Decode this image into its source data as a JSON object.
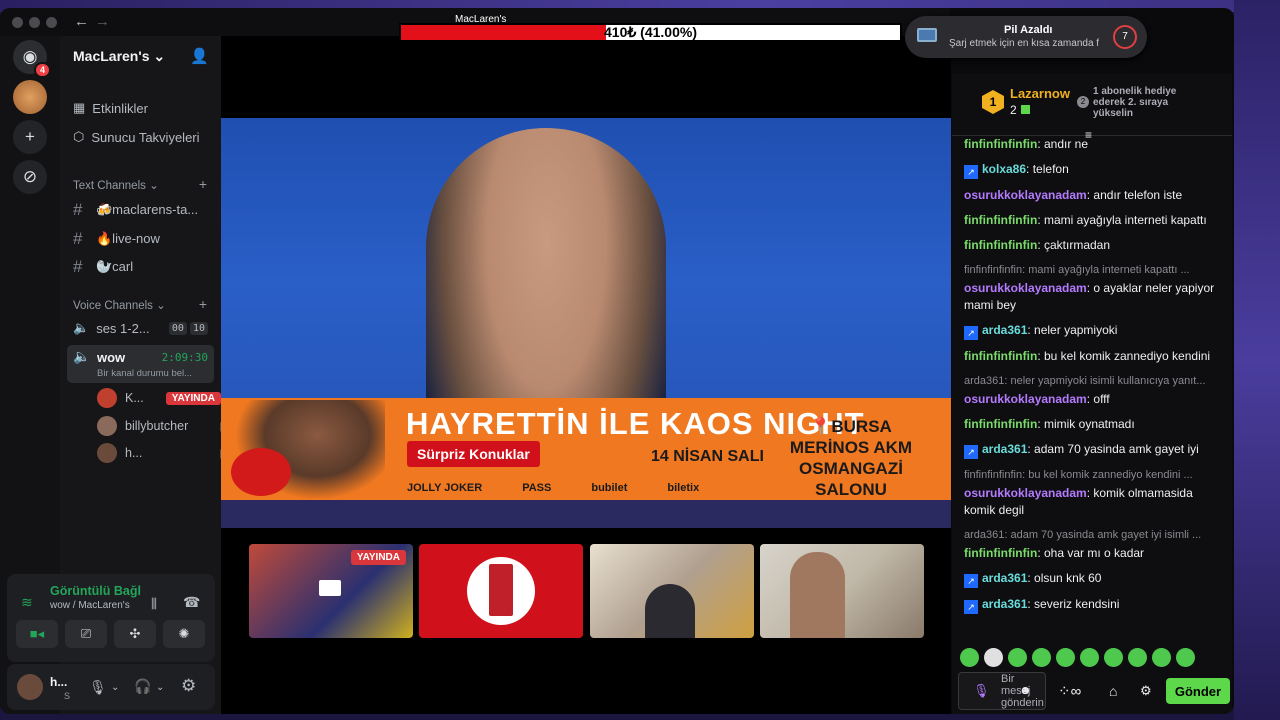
{
  "server": {
    "name": "MacLaren's",
    "discord_badge": "4"
  },
  "sidebar": {
    "top_items": [
      {
        "label": "Etkinlikler",
        "icon": "calendar-icon"
      },
      {
        "label": "Sunucu Takviyeleri",
        "icon": "boost-icon"
      }
    ],
    "text_category": "Text Channels",
    "text_channels": [
      "🍻maclarens-ta...",
      "🔥live-now",
      "🦭carl"
    ],
    "voice_category": "Voice Channels",
    "voice_channels": [
      {
        "name": "ses 1-2...",
        "count_a": "00",
        "count_b": "10"
      },
      {
        "name": "wow",
        "timer": "2:09:30",
        "status": "Bir kanal durumu bel..."
      }
    ],
    "members": [
      {
        "name": "K...",
        "badge": "YAYINDA"
      },
      {
        "name": "billybutcher"
      },
      {
        "name": "h..."
      }
    ]
  },
  "voice_panel": {
    "title": "Görüntülü Bağl",
    "subtitle": "wow / MacLaren's"
  },
  "user_panel": {
    "name": "h...",
    "status": "S"
  },
  "stream": {
    "progress_title": "MacLaren's",
    "progress_text": "410₺ (41.00%)",
    "progress_fraction": 0.41,
    "banner_title": "HAYRETTİN İLE KAOS NIGHT",
    "banner_sub": "Sürpriz Konuklar",
    "banner_date": "14 NİSAN SALI",
    "banner_loc": [
      "BURSA",
      "MERİNOS AKM",
      "OSMANGAZİ SALONU"
    ],
    "banner_logos": [
      "JOLLY JOKER",
      "PASS",
      "bubilet",
      "biletix"
    ],
    "tile_live": "YAYINDA"
  },
  "notification": {
    "title": "Pil Azaldı",
    "body": "Şarj etmek için en kısa zamanda f",
    "count": "7"
  },
  "chat": {
    "top_user": "Lazarnow",
    "top_count": "2",
    "top_rank": "1",
    "gift_rank": "2",
    "gift_text": "1 abonelik hediye ederek 2. sıraya yükselin",
    "messages": [
      {
        "user": "finfinfinfinfin",
        "color": "green",
        "text": "andır ne"
      },
      {
        "user": "kolxa86",
        "color": "cyan",
        "badge": true,
        "text": "telefon"
      },
      {
        "user": "osurukkoklayanadam",
        "color": "purple",
        "text": "andır telefon iste"
      },
      {
        "user": "finfinfinfinfin",
        "color": "green",
        "text": "mami ayağıyla interneti kapattı"
      },
      {
        "user": "finfinfinfinfin",
        "color": "green",
        "text": "çaktırmadan"
      },
      {
        "reply": "finfinfinfinfin: mami ayağıyla interneti kapattı ...",
        "user": "osurukkoklayanadam",
        "color": "purple",
        "text": "o ayaklar neler yapiyor mami bey"
      },
      {
        "user": "arda361",
        "color": "cyan",
        "badge": true,
        "text": "neler yapmiyoki"
      },
      {
        "user": "finfinfinfinfin",
        "color": "green",
        "text": "bu kel komik zannediyo kendini"
      },
      {
        "reply": "arda361: neler yapmiyoki isimli kullanıcıya yanıt...",
        "user": "osurukkoklayanadam",
        "color": "purple",
        "text": "offf"
      },
      {
        "user": "finfinfinfinfin",
        "color": "green",
        "text": "mimik oynatmadı"
      },
      {
        "user": "arda361",
        "color": "cyan",
        "badge": true,
        "text": "adam 70 yasinda amk gayet iyi"
      },
      {
        "reply": "finfinfinfinfin: bu kel komik zannediyo kendini ...",
        "user": "osurukkoklayanadam",
        "color": "purple",
        "text": "komik olmamasida komik degil"
      },
      {
        "reply": "arda361: adam 70 yasinda amk gayet iyi isimli ...",
        "user": "finfinfinfinfin",
        "color": "green",
        "text": "oha var mı o kadar"
      },
      {
        "user": "arda361",
        "color": "cyan",
        "badge": true,
        "text": "olsun knk 60"
      },
      {
        "user": "arda361",
        "color": "cyan",
        "badge": true,
        "text": "severiz kendsini"
      }
    ],
    "input_placeholder": "Bir mesaj gönderin",
    "send_label": "Gönder"
  }
}
